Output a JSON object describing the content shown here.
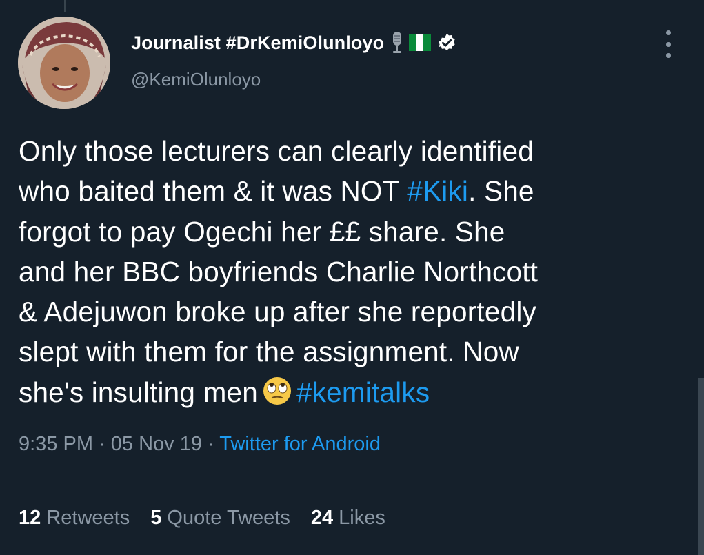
{
  "author": {
    "display_name": "Journalist #DrKemiOlunloyo",
    "handle": "@KemiOlunloyo",
    "badges": [
      "microphone-icon",
      "nigeria-flag-icon",
      "verified-badge-icon"
    ]
  },
  "tweet": {
    "lines": [
      [
        {
          "t": "Only those lecturers can clearly identified"
        }
      ],
      [
        {
          "t": "who baited them & it was NOT "
        },
        {
          "t": "#Kiki",
          "link": true
        },
        {
          "t": ". She"
        }
      ],
      [
        {
          "t": "forgot to pay Ogechi her ££ share. She"
        }
      ],
      [
        {
          "t": "and her BBC boyfriends Charlie Northcott"
        }
      ],
      [
        {
          "t": "& Adejuwon broke up after she reportedly"
        }
      ],
      [
        {
          "t": "slept with them for the assignment. Now"
        }
      ],
      [
        {
          "t": "she's insulting men"
        },
        {
          "emoji": "face-with-rolling-eyes-icon"
        },
        {
          "t": "#kemitalks",
          "link": true
        }
      ]
    ]
  },
  "meta": {
    "time": "9:35 PM",
    "sep1": " · ",
    "date": "05 Nov 19",
    "sep2": " · ",
    "source": "Twitter for Android"
  },
  "stats": [
    {
      "count": "12",
      "label": "Retweets"
    },
    {
      "count": "5",
      "label": "Quote Tweets"
    },
    {
      "count": "24",
      "label": "Likes"
    }
  ],
  "colors": {
    "background": "#15202b",
    "link": "#1d9bf0",
    "secondary_text": "#8b98a5"
  }
}
